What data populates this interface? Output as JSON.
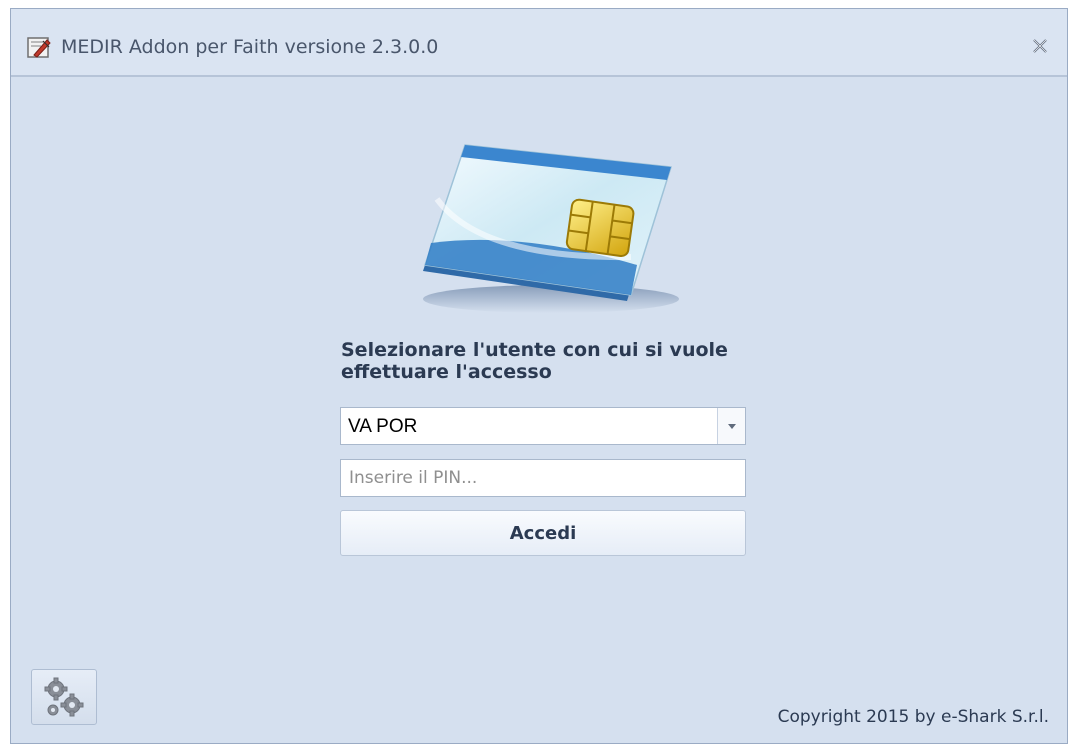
{
  "window": {
    "title": "MEDIR Addon per Faith versione 2.3.0.0"
  },
  "login": {
    "heading": "Selezionare l'utente con cui si vuole effettuare l'accesso",
    "user_select": {
      "value": "VA POR"
    },
    "pin": {
      "placeholder": "Inserire il PIN...",
      "value": ""
    },
    "submit_label": "Accedi"
  },
  "footer": {
    "copyright": "Copyright 2015 by e-Shark S.r.l."
  },
  "icons": {
    "app": "app-logo-icon",
    "close": "close-icon",
    "card": "smart-card-icon",
    "dropdown": "chevron-down-icon",
    "settings": "gears-icon"
  },
  "colors": {
    "window_bg": "#d5e0ef",
    "heading_text": "#2b3a52",
    "card_blue": "#2b6fc0",
    "chip_gold": "#e6c12a"
  }
}
